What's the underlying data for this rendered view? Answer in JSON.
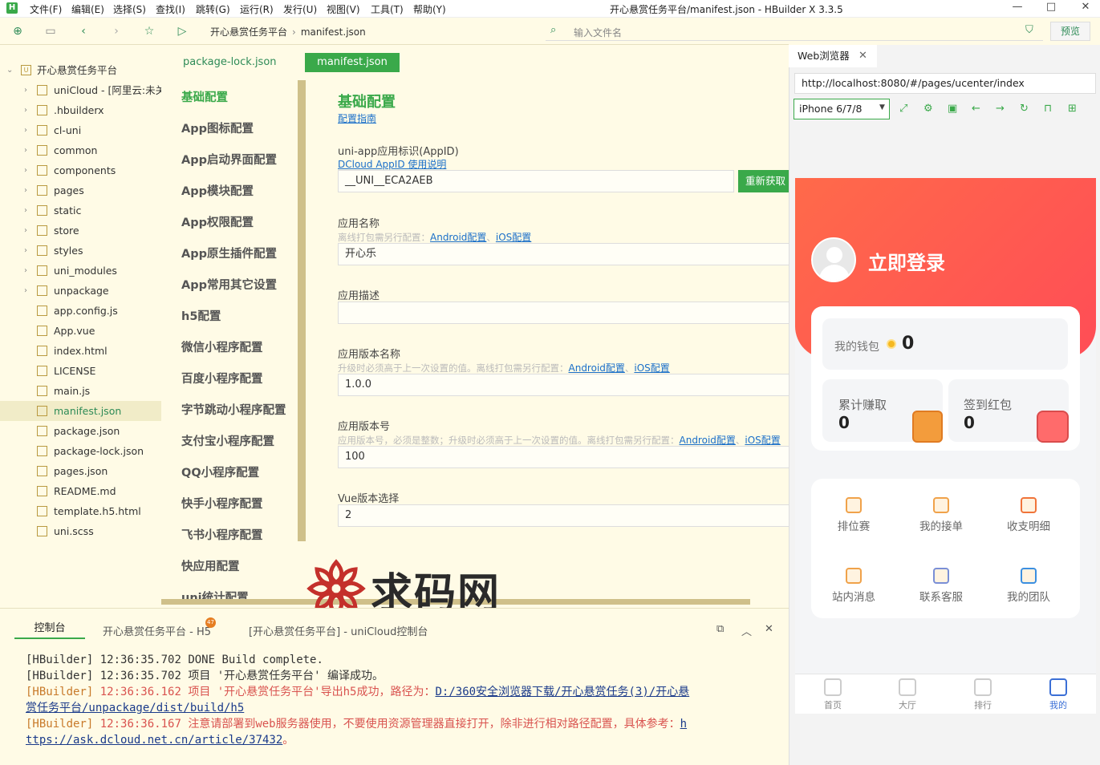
{
  "titlebar": {
    "logo": "H",
    "menu": [
      "文件(F)",
      "编辑(E)",
      "选择(S)",
      "查找(I)",
      "跳转(G)",
      "运行(R)",
      "发行(U)",
      "视图(V)",
      "工具(T)",
      "帮助(Y)"
    ],
    "window_title": "开心悬赏任务平台/manifest.json - HBuilder X 3.3.5",
    "controls": [
      "—",
      "□",
      "✕"
    ]
  },
  "toolbar": {
    "crumb_project": "开心悬赏任务平台",
    "crumb_file": "manifest.json",
    "search_placeholder": "输入文件名",
    "preview": "预览"
  },
  "tree": {
    "root": "开心悬赏任务平台",
    "items": [
      {
        "label": "uniCloud - [阿里云:未关联]",
        "folder": true
      },
      {
        "label": ".hbuilderx",
        "folder": true
      },
      {
        "label": "cl-uni",
        "folder": true
      },
      {
        "label": "common",
        "folder": true
      },
      {
        "label": "components",
        "folder": true
      },
      {
        "label": "pages",
        "folder": true
      },
      {
        "label": "static",
        "folder": true
      },
      {
        "label": "store",
        "folder": true
      },
      {
        "label": "styles",
        "folder": true
      },
      {
        "label": "uni_modules",
        "folder": true
      },
      {
        "label": "unpackage",
        "folder": true
      },
      {
        "label": "app.config.js",
        "folder": false
      },
      {
        "label": "App.vue",
        "folder": false
      },
      {
        "label": "index.html",
        "folder": false
      },
      {
        "label": "LICENSE",
        "folder": false
      },
      {
        "label": "main.js",
        "folder": false
      },
      {
        "label": "manifest.json",
        "folder": false,
        "selected": true
      },
      {
        "label": "package.json",
        "folder": false
      },
      {
        "label": "package-lock.json",
        "folder": false
      },
      {
        "label": "pages.json",
        "folder": false
      },
      {
        "label": "README.md",
        "folder": false
      },
      {
        "label": "template.h5.html",
        "folder": false
      },
      {
        "label": "uni.scss",
        "folder": false
      }
    ]
  },
  "editor_tabs": [
    "package-lock.json",
    "manifest.json"
  ],
  "cfgnav": [
    "基础配置",
    "App图标配置",
    "App启动界面配置",
    "App模块配置",
    "App权限配置",
    "App原生插件配置",
    "App常用其它设置",
    "h5配置",
    "微信小程序配置",
    "百度小程序配置",
    "字节跳动小程序配置",
    "支付宝小程序配置",
    "QQ小程序配置",
    "快手小程序配置",
    "飞书小程序配置",
    "快应用配置",
    "uni统计配置"
  ],
  "form": {
    "title": "基础配置",
    "guide_link": "配置指南",
    "appid_label": "uni-app应用标识(AppID)",
    "appid_link": "DCloud AppID 使用说明",
    "appid_value": "__UNI__ECA2AEB",
    "reget_button": "重新获取",
    "name_label": "应用名称",
    "name_hint": "离线打包需另行配置：",
    "link_android": "Android配置",
    "link_ios": "iOS配置",
    "name_value": "开心乐",
    "desc_label": "应用描述",
    "desc_value": "",
    "vername_label": "应用版本名称",
    "vername_hint": "升级时必须高于上一次设置的值。离线打包需另行配置：",
    "vername_value": "1.0.0",
    "vercode_label": "应用版本号",
    "vercode_hint": "应用版本号，必须是整数；升级时必须高于上一次设置的值。离线打包需另行配置：",
    "vercode_value": "100",
    "vue_label": "Vue版本选择",
    "vue_value": "2"
  },
  "console": {
    "tab_active": "控制台",
    "tab_h5": "开心悬赏任务平台 - H5",
    "badge": "47",
    "tab_cloud": "[开心悬赏任务平台] - uniCloud控制台",
    "logs": [
      {
        "tag": "[HBuilder]",
        "time": "12:36:35.702",
        "text": " DONE  Build complete."
      },
      {
        "tag": "[HBuilder]",
        "time": "12:36:35.702",
        "text": "项目 '开心悬赏任务平台' 编译成功。"
      },
      {
        "tag": "[HBuilder]",
        "time": "12:36:36.162",
        "text": "项目 '开心悬赏任务平台'导出h5成功，路径为：",
        "path": "D:/360安全浏览器下载/开心悬赏任务(3)/开心悬"
      },
      {
        "path": "赏任务平台/unpackage/dist/build/h5"
      },
      {
        "tag": "[HBuilder]",
        "time": "12:36:36.167",
        "text": "注意请部署到web服务器使用，不要使用资源管理器直接打开，除非进行相对路径配置，具体参考：",
        "path": "h"
      },
      {
        "path": "ttps://ask.dcloud.net.cn/article/37432",
        "suffix": "。"
      }
    ]
  },
  "web": {
    "tab": "Web浏览器",
    "url": "http://localhost:8080/#/pages/ucenter/index",
    "device": "iPhone 6/7/8",
    "login": "立即登录",
    "wallet_label": "我的钱包",
    "wallet_value": "0",
    "earn_label": "累计赚取",
    "earn_value": "0",
    "red_label": "签到红包",
    "red_value": "0",
    "grid": [
      "排位赛",
      "我的接单",
      "收支明细",
      "站内消息",
      "联系客服",
      "我的团队"
    ],
    "tabs": [
      "首页",
      "大厅",
      "排行",
      "我的"
    ]
  },
  "watermark": "求码网",
  "colors": {
    "accent": "#3aa94a",
    "link": "#1a6fc9",
    "brand_red": "#ff5a50",
    "active_tab": "#3b6fd6"
  }
}
